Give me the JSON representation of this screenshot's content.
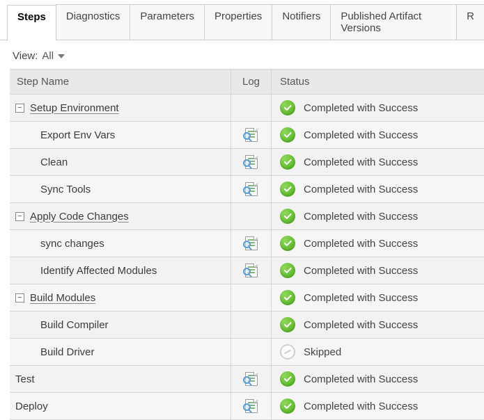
{
  "tabs": [
    {
      "label": "Steps",
      "active": true
    },
    {
      "label": "Diagnostics",
      "active": false
    },
    {
      "label": "Parameters",
      "active": false
    },
    {
      "label": "Properties",
      "active": false
    },
    {
      "label": "Notifiers",
      "active": false
    },
    {
      "label": "Published Artifact Versions",
      "active": false
    },
    {
      "label": "R",
      "active": false
    }
  ],
  "view": {
    "label": "View:",
    "value": "All"
  },
  "columns": {
    "name": "Step Name",
    "log": "Log",
    "status": "Status"
  },
  "status_labels": {
    "success": "Completed with Success",
    "skipped": "Skipped"
  },
  "steps": [
    {
      "label": "Setup Environment",
      "indent": 0,
      "expandable": true,
      "underlined": true,
      "hasLog": false,
      "status": "success"
    },
    {
      "label": "Export Env Vars",
      "indent": 1,
      "expandable": false,
      "underlined": false,
      "hasLog": true,
      "status": "success"
    },
    {
      "label": "Clean",
      "indent": 1,
      "expandable": false,
      "underlined": false,
      "hasLog": true,
      "status": "success"
    },
    {
      "label": "Sync Tools",
      "indent": 1,
      "expandable": false,
      "underlined": false,
      "hasLog": true,
      "status": "success"
    },
    {
      "label": "Apply Code Changes",
      "indent": 0,
      "expandable": true,
      "underlined": true,
      "hasLog": false,
      "status": "success"
    },
    {
      "label": "sync changes",
      "indent": 1,
      "expandable": false,
      "underlined": false,
      "hasLog": true,
      "status": "success"
    },
    {
      "label": "Identify Affected Modules",
      "indent": 1,
      "expandable": false,
      "underlined": false,
      "hasLog": true,
      "status": "success"
    },
    {
      "label": "Build Modules",
      "indent": 0,
      "expandable": true,
      "underlined": true,
      "hasLog": false,
      "status": "success"
    },
    {
      "label": "Build Compiler",
      "indent": 1,
      "expandable": false,
      "underlined": false,
      "hasLog": false,
      "status": "success"
    },
    {
      "label": "Build Driver",
      "indent": 1,
      "expandable": false,
      "underlined": false,
      "hasLog": false,
      "status": "skipped"
    },
    {
      "label": "Test",
      "indent": 0,
      "expandable": false,
      "underlined": false,
      "hasLog": true,
      "status": "success"
    },
    {
      "label": "Deploy",
      "indent": 0,
      "expandable": false,
      "underlined": false,
      "hasLog": true,
      "status": "success"
    }
  ]
}
